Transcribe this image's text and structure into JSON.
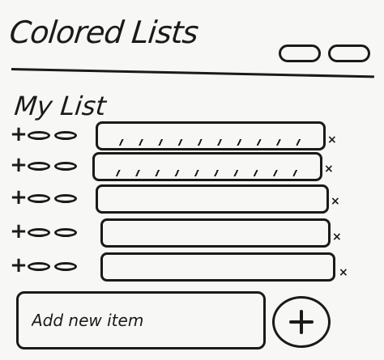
{
  "app": {
    "title": "Colored Lists"
  },
  "list": {
    "title": "My List",
    "items": [
      {
        "value": "",
        "checked": true
      },
      {
        "value": "",
        "checked": true
      },
      {
        "value": "",
        "checked": false
      },
      {
        "value": "",
        "checked": false
      },
      {
        "value": "",
        "checked": false
      }
    ]
  },
  "add": {
    "placeholder": "Add new item"
  },
  "icons": {
    "increase": "plus-icon",
    "color_a": "color-oval-icon",
    "color_b": "color-oval-icon",
    "remove": "close-icon",
    "add": "plus-circle-icon"
  },
  "colors": {
    "ink": "#1a1a1a",
    "paper": "#f7f7f5"
  }
}
